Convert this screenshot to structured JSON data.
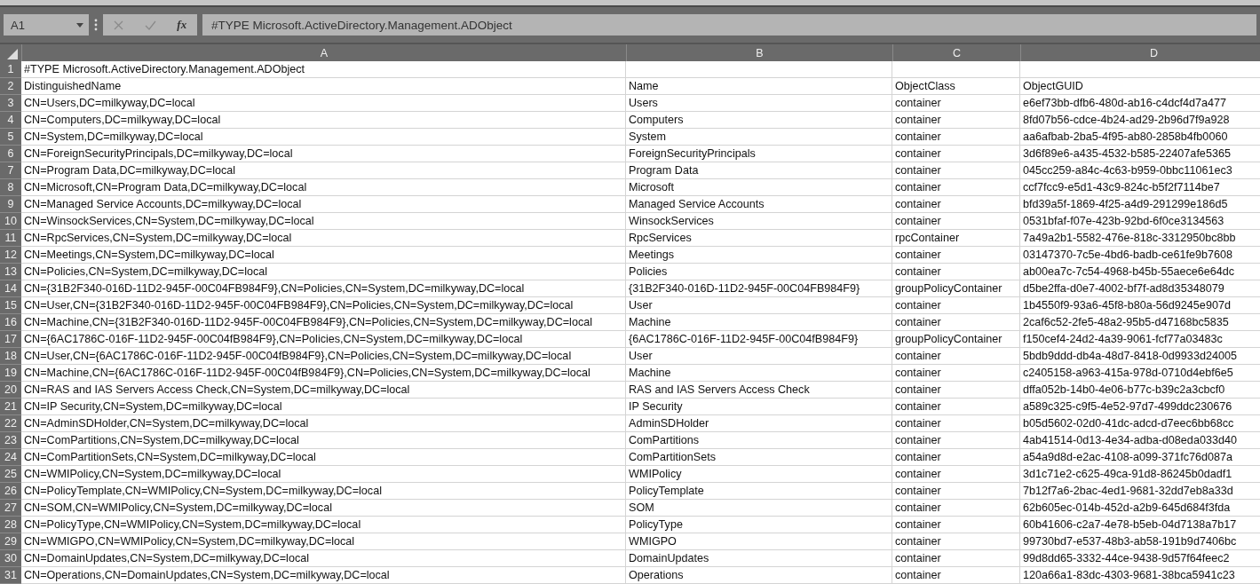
{
  "name_box": "A1",
  "function_label": "fx",
  "formula": "#TYPE Microsoft.ActiveDirectory.Management.ADObject",
  "columns": [
    "A",
    "B",
    "C",
    "D"
  ],
  "rows": [
    {
      "number": "1",
      "cells": [
        "#TYPE Microsoft.ActiveDirectory.Management.ADObject"
      ]
    },
    {
      "number": "2",
      "cells": [
        "DistinguishedName",
        "Name",
        "ObjectClass",
        "ObjectGUID"
      ]
    },
    {
      "number": "3",
      "cells": [
        "CN=Users,DC=milkyway,DC=local",
        "Users",
        "container",
        "e6ef73bb-dfb6-480d-ab16-c4dcf4d7a477"
      ]
    },
    {
      "number": "4",
      "cells": [
        "CN=Computers,DC=milkyway,DC=local",
        "Computers",
        "container",
        "8fd07b56-cdce-4b24-ad29-2b96d7f9a928"
      ]
    },
    {
      "number": "5",
      "cells": [
        "CN=System,DC=milkyway,DC=local",
        "System",
        "container",
        "aa6afbab-2ba5-4f95-ab80-2858b4fb0060"
      ]
    },
    {
      "number": "6",
      "cells": [
        "CN=ForeignSecurityPrincipals,DC=milkyway,DC=local",
        "ForeignSecurityPrincipals",
        "container",
        "3d6f89e6-a435-4532-b585-22407afe5365"
      ]
    },
    {
      "number": "7",
      "cells": [
        "CN=Program Data,DC=milkyway,DC=local",
        "Program Data",
        "container",
        "045cc259-a84c-4c63-b959-0bbc11061ec3"
      ]
    },
    {
      "number": "8",
      "cells": [
        "CN=Microsoft,CN=Program Data,DC=milkyway,DC=local",
        "Microsoft",
        "container",
        "ccf7fcc9-e5d1-43c9-824c-b5f2f7114be7"
      ]
    },
    {
      "number": "9",
      "cells": [
        "CN=Managed Service Accounts,DC=milkyway,DC=local",
        "Managed Service Accounts",
        "container",
        "bfd39a5f-1869-4f25-a4d9-291299e186d5"
      ]
    },
    {
      "number": "10",
      "cells": [
        "CN=WinsockServices,CN=System,DC=milkyway,DC=local",
        "WinsockServices",
        "container",
        "0531bfaf-f07e-423b-92bd-6f0ce3134563"
      ]
    },
    {
      "number": "11",
      "cells": [
        "CN=RpcServices,CN=System,DC=milkyway,DC=local",
        "RpcServices",
        "rpcContainer",
        "7a49a2b1-5582-476e-818c-3312950bc8bb"
      ]
    },
    {
      "number": "12",
      "cells": [
        "CN=Meetings,CN=System,DC=milkyway,DC=local",
        "Meetings",
        "container",
        "03147370-7c5e-4bd6-badb-ce61fe9b7608"
      ]
    },
    {
      "number": "13",
      "cells": [
        "CN=Policies,CN=System,DC=milkyway,DC=local",
        "Policies",
        "container",
        "ab00ea7c-7c54-4968-b45b-55aece6e64dc"
      ]
    },
    {
      "number": "14",
      "cells": [
        "CN={31B2F340-016D-11D2-945F-00C04FB984F9},CN=Policies,CN=System,DC=milkyway,DC=local",
        "{31B2F340-016D-11D2-945F-00C04FB984F9}",
        "groupPolicyContainer",
        "d5be2ffa-d0e7-4002-bf7f-ad8d35348079"
      ]
    },
    {
      "number": "15",
      "cells": [
        "CN=User,CN={31B2F340-016D-11D2-945F-00C04FB984F9},CN=Policies,CN=System,DC=milkyway,DC=local",
        "User",
        "container",
        "1b4550f9-93a6-45f8-b80a-56d9245e907d"
      ]
    },
    {
      "number": "16",
      "cells": [
        "CN=Machine,CN={31B2F340-016D-11D2-945F-00C04FB984F9},CN=Policies,CN=System,DC=milkyway,DC=local",
        "Machine",
        "container",
        "2caf6c52-2fe5-48a2-95b5-d47168bc5835"
      ]
    },
    {
      "number": "17",
      "cells": [
        "CN={6AC1786C-016F-11D2-945F-00C04fB984F9},CN=Policies,CN=System,DC=milkyway,DC=local",
        "{6AC1786C-016F-11D2-945F-00C04fB984F9}",
        "groupPolicyContainer",
        "f150cef4-24d2-4a39-9061-fcf77a03483c"
      ]
    },
    {
      "number": "18",
      "cells": [
        "CN=User,CN={6AC1786C-016F-11D2-945F-00C04fB984F9},CN=Policies,CN=System,DC=milkyway,DC=local",
        "User",
        "container",
        "5bdb9ddd-db4a-48d7-8418-0d9933d24005"
      ]
    },
    {
      "number": "19",
      "cells": [
        "CN=Machine,CN={6AC1786C-016F-11D2-945F-00C04fB984F9},CN=Policies,CN=System,DC=milkyway,DC=local",
        "Machine",
        "container",
        "c2405158-a963-415a-978d-0710d4ebf6e5"
      ]
    },
    {
      "number": "20",
      "cells": [
        "CN=RAS and IAS Servers Access Check,CN=System,DC=milkyway,DC=local",
        "RAS and IAS Servers Access Check",
        "container",
        "dffa052b-14b0-4e06-b77c-b39c2a3cbcf0"
      ]
    },
    {
      "number": "21",
      "cells": [
        "CN=IP Security,CN=System,DC=milkyway,DC=local",
        "IP Security",
        "container",
        "a589c325-c9f5-4e52-97d7-499ddc230676"
      ]
    },
    {
      "number": "22",
      "cells": [
        "CN=AdminSDHolder,CN=System,DC=milkyway,DC=local",
        "AdminSDHolder",
        "container",
        "b05d5602-02d0-41dc-adcd-d7eec6bb68cc"
      ]
    },
    {
      "number": "23",
      "cells": [
        "CN=ComPartitions,CN=System,DC=milkyway,DC=local",
        "ComPartitions",
        "container",
        "4ab41514-0d13-4e34-adba-d08eda033d40"
      ]
    },
    {
      "number": "24",
      "cells": [
        "CN=ComPartitionSets,CN=System,DC=milkyway,DC=local",
        "ComPartitionSets",
        "container",
        "a54a9d8d-e2ac-4108-a099-371fc76d087a"
      ]
    },
    {
      "number": "25",
      "cells": [
        "CN=WMIPolicy,CN=System,DC=milkyway,DC=local",
        "WMIPolicy",
        "container",
        "3d1c71e2-c625-49ca-91d8-86245b0dadf1"
      ]
    },
    {
      "number": "26",
      "cells": [
        "CN=PolicyTemplate,CN=WMIPolicy,CN=System,DC=milkyway,DC=local",
        "PolicyTemplate",
        "container",
        "7b12f7a6-2bac-4ed1-9681-32dd7eb8a33d"
      ]
    },
    {
      "number": "27",
      "cells": [
        "CN=SOM,CN=WMIPolicy,CN=System,DC=milkyway,DC=local",
        "SOM",
        "container",
        "62b605ec-014b-452d-a2b9-645d684f3fda"
      ]
    },
    {
      "number": "28",
      "cells": [
        "CN=PolicyType,CN=WMIPolicy,CN=System,DC=milkyway,DC=local",
        "PolicyType",
        "container",
        "60b41606-c2a7-4e78-b5eb-04d7138a7b17"
      ]
    },
    {
      "number": "29",
      "cells": [
        "CN=WMIGPO,CN=WMIPolicy,CN=System,DC=milkyway,DC=local",
        "WMIGPO",
        "container",
        "99730bd7-e537-48b3-ab58-191b9d7406bc"
      ]
    },
    {
      "number": "30",
      "cells": [
        "CN=DomainUpdates,CN=System,DC=milkyway,DC=local",
        "DomainUpdates",
        "container",
        "99d8dd65-3332-44ce-9438-9d57f64feec2"
      ]
    },
    {
      "number": "31",
      "cells": [
        "CN=Operations,CN=DomainUpdates,CN=System,DC=milkyway,DC=local",
        "Operations",
        "container",
        "120a66a1-83dc-4303-9681-38bca5941c23"
      ]
    }
  ]
}
